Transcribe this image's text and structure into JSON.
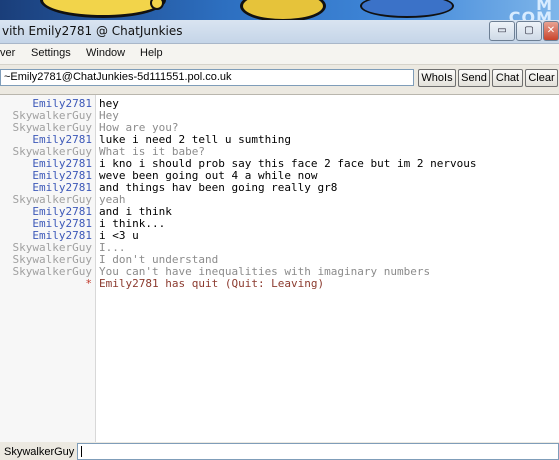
{
  "window": {
    "title": "vith Emily2781 @ ChatJunkies",
    "controls": {
      "minimize": "▭",
      "maximize": "▢",
      "close": "✕"
    }
  },
  "wallpaper": {
    "logo_line1": "M",
    "logo_line2": "COM"
  },
  "menu": [
    {
      "label": "ver"
    },
    {
      "label": "Settings"
    },
    {
      "label": "Window"
    },
    {
      "label": "Help"
    }
  ],
  "toolbar": {
    "topic": "~Emily2781@ChatJunkies-5d111551.pol.co.uk",
    "buttons": [
      "WhoIs",
      "Send",
      "Chat",
      "Clear"
    ]
  },
  "chat": {
    "lines": [
      {
        "nick": "Emily2781",
        "text": "hey",
        "who": "emily"
      },
      {
        "nick": "SkywalkerGuy",
        "text": "Hey",
        "who": "sky"
      },
      {
        "nick": "SkywalkerGuy",
        "text": "How are you?",
        "who": "sky"
      },
      {
        "nick": "Emily2781",
        "text": "luke i need 2 tell u sumthing",
        "who": "emily"
      },
      {
        "nick": "SkywalkerGuy",
        "text": "What is it babe?",
        "who": "sky"
      },
      {
        "nick": "Emily2781",
        "text": "i kno i should prob say this face 2 face but im 2 nervous",
        "who": "emily"
      },
      {
        "nick": "Emily2781",
        "text": "weve been going out 4 a while now",
        "who": "emily"
      },
      {
        "nick": "Emily2781",
        "text": "and things hav been going really gr8",
        "who": "emily"
      },
      {
        "nick": "SkywalkerGuy",
        "text": "yeah",
        "who": "sky"
      },
      {
        "nick": "Emily2781",
        "text": "and i think",
        "who": "emily"
      },
      {
        "nick": "Emily2781",
        "text": "i think...",
        "who": "emily"
      },
      {
        "nick": "Emily2781",
        "text": "i <3 u",
        "who": "emily"
      },
      {
        "nick": "SkywalkerGuy",
        "text": "I...",
        "who": "sky"
      },
      {
        "nick": "SkywalkerGuy",
        "text": "I don't understand",
        "who": "sky"
      },
      {
        "nick": "SkywalkerGuy",
        "text": "You can't have inequalities with imaginary numbers",
        "who": "sky"
      },
      {
        "nick": "*",
        "text": "Emily2781 has quit (Quit: Leaving)",
        "who": "system"
      }
    ]
  },
  "input": {
    "nickname": "SkywalkerGuy",
    "value": ""
  },
  "colors": {
    "emily_nick": "#3c58b8",
    "sky_nick": "#a0a0a0",
    "quit_text": "#8b3a2e"
  }
}
